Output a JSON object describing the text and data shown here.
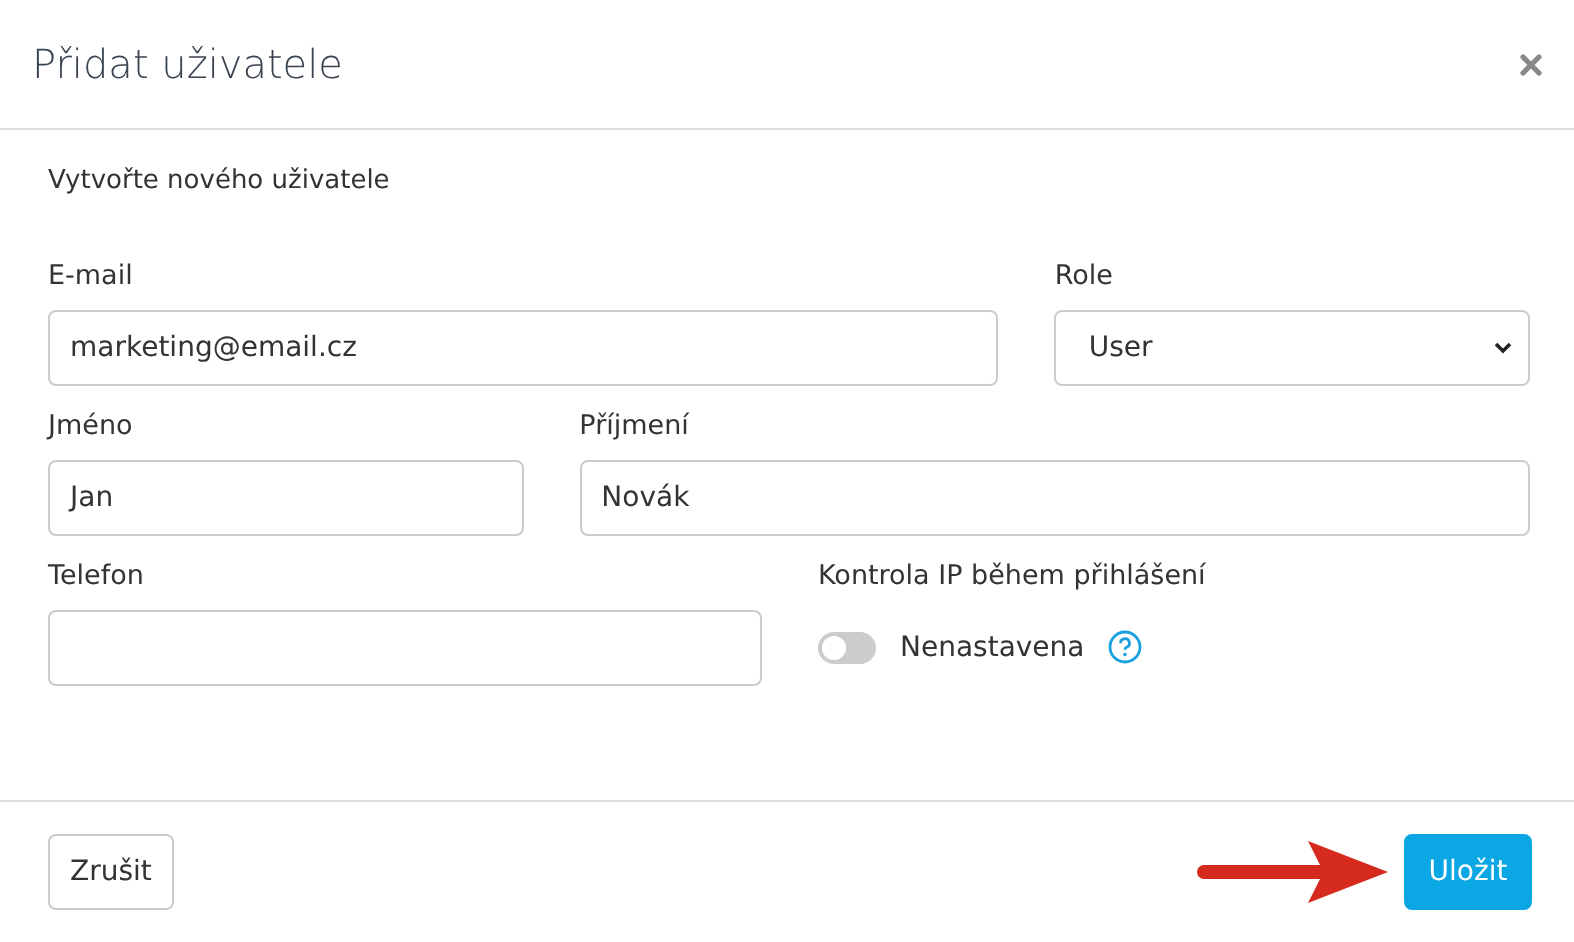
{
  "dialog": {
    "title": "Přidat uživatele",
    "subtitle": "Vytvořte nového uživatele"
  },
  "fields": {
    "email": {
      "label": "E-mail",
      "value": "marketing@email.cz"
    },
    "role": {
      "label": "Role",
      "value": "User"
    },
    "first_name": {
      "label": "Jméno",
      "value": "Jan"
    },
    "last_name": {
      "label": "Příjmení",
      "value": "Novák"
    },
    "phone": {
      "label": "Telefon"
    }
  },
  "ip_check": {
    "label": "Kontrola IP během přihlášení",
    "on": false,
    "status": "Nenastavena"
  },
  "buttons": {
    "cancel": "Zrušit",
    "save": "Uložit"
  }
}
